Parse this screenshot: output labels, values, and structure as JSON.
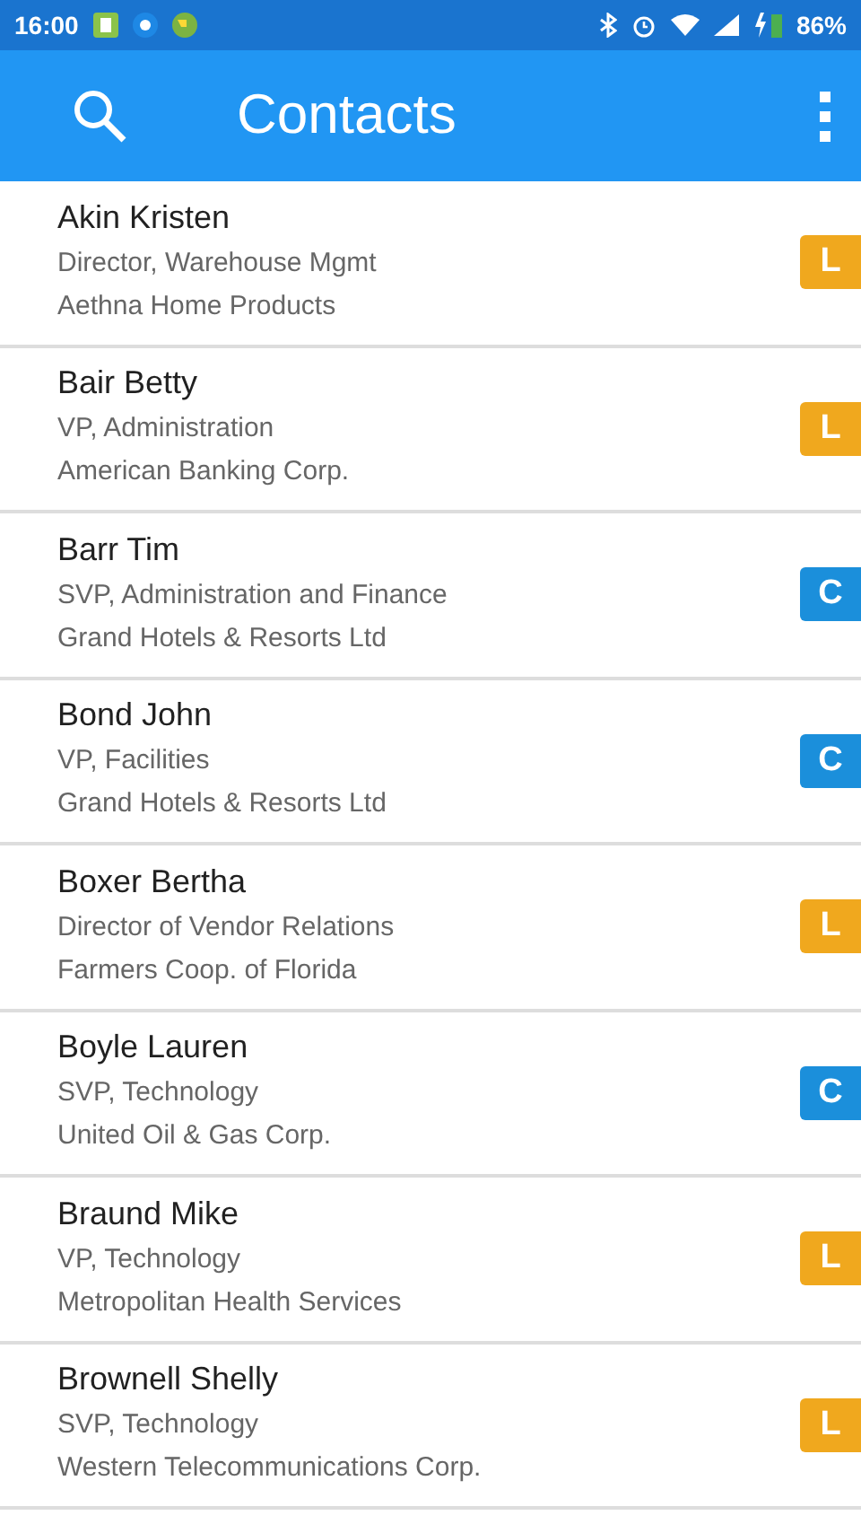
{
  "status_bar": {
    "time": "16:00",
    "battery": "86%"
  },
  "app_bar": {
    "title": "Contacts"
  },
  "contacts": [
    {
      "name": "Akin Kristen",
      "title": "Director, Warehouse Mgmt",
      "company": "Aethna Home Products",
      "badge": "L",
      "color": "#f0a81e"
    },
    {
      "name": "Bair Betty",
      "title": "VP, Administration",
      "company": "American Banking Corp.",
      "badge": "L",
      "color": "#f0a81e"
    },
    {
      "name": "Barr Tim",
      "title": "SVP, Administration and Finance",
      "company": "Grand Hotels & Resorts Ltd",
      "badge": "C",
      "color": "#1b8fdb"
    },
    {
      "name": "Bond John",
      "title": "VP, Facilities",
      "company": "Grand Hotels & Resorts Ltd",
      "badge": "C",
      "color": "#1b8fdb"
    },
    {
      "name": "Boxer Bertha",
      "title": "Director of Vendor Relations",
      "company": "Farmers Coop. of Florida",
      "badge": "L",
      "color": "#f0a81e"
    },
    {
      "name": "Boyle Lauren",
      "title": "SVP, Technology",
      "company": "United Oil & Gas Corp.",
      "badge": "C",
      "color": "#1b8fdb"
    },
    {
      "name": "Braund Mike",
      "title": "VP, Technology",
      "company": "Metropolitan Health Services",
      "badge": "L",
      "color": "#f0a81e"
    },
    {
      "name": "Brownell Shelly",
      "title": "SVP, Technology",
      "company": "Western Telecommunications Corp.",
      "badge": "L",
      "color": "#f0a81e"
    }
  ]
}
